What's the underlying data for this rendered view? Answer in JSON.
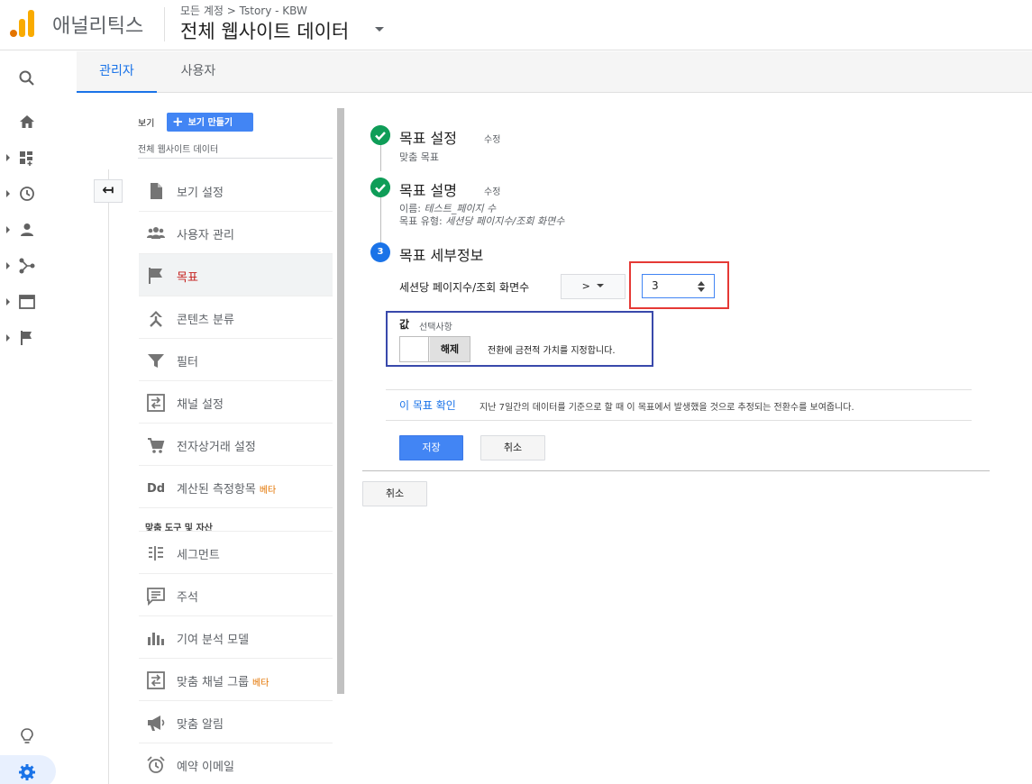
{
  "header": {
    "brand": "애널리틱스",
    "breadcrumb": "모든 계정 > Tstory - KBW",
    "property": "전체 웹사이트 데이터"
  },
  "tabs": [
    {
      "label": "관리자",
      "active": true
    },
    {
      "label": "사용자",
      "active": false
    }
  ],
  "view": {
    "label": "보기",
    "create_button": "보기 만들기",
    "name": "전체 웹사이트 데이터"
  },
  "menu": [
    {
      "label": "보기 설정",
      "icon": "document-icon"
    },
    {
      "label": "사용자 관리",
      "icon": "people-icon"
    },
    {
      "label": "목표",
      "icon": "flag-icon",
      "active": true
    },
    {
      "label": "콘텐츠 분류",
      "icon": "content-grouping-icon"
    },
    {
      "label": "필터",
      "icon": "filter-icon"
    },
    {
      "label": "채널 설정",
      "icon": "channel-icon"
    },
    {
      "label": "전자상거래 설정",
      "icon": "cart-icon"
    },
    {
      "label": "계산된 측정항목",
      "icon": "dd-icon",
      "beta": "베타"
    }
  ],
  "section_label": "맞춤 도구 및 자산",
  "menu2": [
    {
      "label": "세그먼트",
      "icon": "segment-icon"
    },
    {
      "label": "주석",
      "icon": "annotation-icon"
    },
    {
      "label": "기여 분석 모델",
      "icon": "attribution-icon"
    },
    {
      "label": "맞춤 채널 그룹",
      "icon": "channel-group-icon",
      "beta": "베타"
    },
    {
      "label": "맞춤 알림",
      "icon": "megaphone-icon"
    },
    {
      "label": "예약 이메일",
      "icon": "alarm-icon"
    }
  ],
  "goal": {
    "step1": {
      "title": "목표 설정",
      "edit": "수정",
      "sub": "맞춤 목표"
    },
    "step2": {
      "title": "목표 설명",
      "edit": "수정",
      "name_label": "이름:",
      "name_value": "테스트_페이지 수",
      "type_label": "목표 유형:",
      "type_value": "세션당 페이지수/조회 화면수"
    },
    "step3": {
      "number": "3",
      "title": "목표 세부정보"
    },
    "field_label": "세션당 페이지수/조회 화면수",
    "operator": ">",
    "input_value": "3",
    "value_label": "값",
    "value_optional": "선택사항",
    "toggle_label": "해제",
    "toggle_desc": "전환에 금전적 가치를 지정합니다.",
    "verify_link": "이 목표 확인",
    "verify_desc": "지난 7일간의 데이터를 기준으로 할 때 이 목표에서 발생했을 것으로 추정되는 전환수를 보여줍니다.",
    "save": "저장",
    "cancel": "취소",
    "cancel_outer": "취소"
  },
  "colors": {
    "accent": "#1a73e8",
    "success": "#0f9d58",
    "highlight_red": "#e53935",
    "highlight_blue": "#3949ab"
  }
}
